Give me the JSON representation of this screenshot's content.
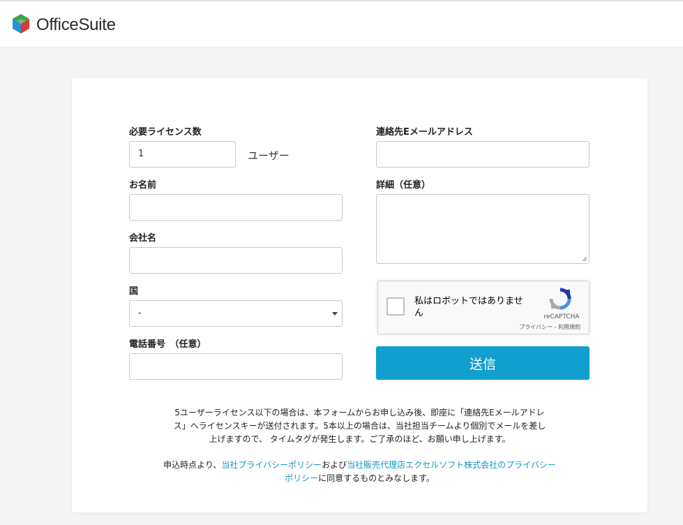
{
  "brand": {
    "name": "OfficeSuite",
    "colors": {
      "logo_blue": "#2b8fd6",
      "logo_red": "#d93a3a",
      "logo_green": "#3aa64a",
      "accent": "#119fcf",
      "link": "#1496c7"
    }
  },
  "form": {
    "license_count": {
      "label": "必要ライセンス数",
      "value": "1",
      "suffix": "ユーザー"
    },
    "email": {
      "label": "連絡先Eメールアドレス",
      "value": ""
    },
    "name": {
      "label": "お名前",
      "value": ""
    },
    "details": {
      "label": "詳細（任意）",
      "value": ""
    },
    "company": {
      "label": "会社名",
      "value": ""
    },
    "country": {
      "label": "国",
      "selected": "-"
    },
    "phone": {
      "label": "電話番号　（任意）",
      "value": ""
    },
    "recaptcha": {
      "checkbox_label": "私はロボットではありません",
      "brand": "reCAPTCHA",
      "links": "プライバシー - 利用規約",
      "icon": "recaptcha-icon"
    },
    "submit_label": "送信"
  },
  "notice": {
    "text": "5ユーザーライセンス以下の場合は、本フォームからお申し込み後、即座に「連絡先Eメールアドレス」へライセンスキーが送付されます。5本以上の場合は、当社担当チームより個別でメールを差し上げますので、 タイムタグが発生します。ご了承のほど、お願い申し上げます。",
    "consent_prefix": "申込時点より、",
    "privacy_link_1": "当社プライバシーポリシー",
    "consent_middle": "および",
    "privacy_link_2": "当社販売代理店エクセルソフト株式会社のプライバシーポリシー",
    "consent_suffix": "に同意するものとみなします。"
  }
}
